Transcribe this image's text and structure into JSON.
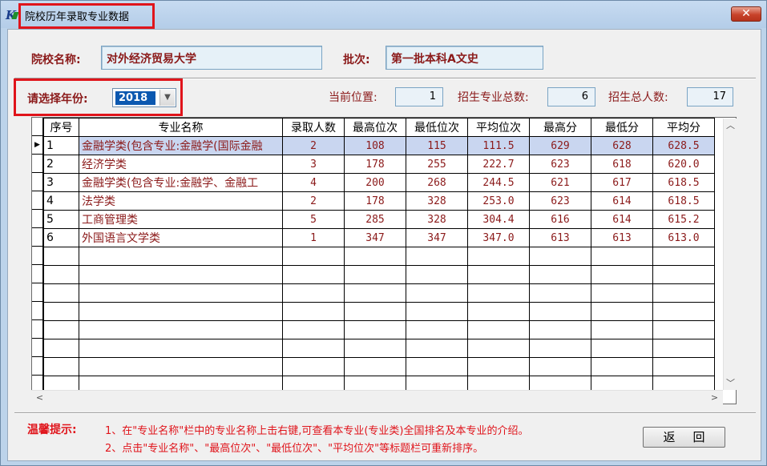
{
  "window": {
    "title": "院校历年录取专业数据",
    "close_label": "✕"
  },
  "school": {
    "name_label": "院校名称:",
    "name_value": "对外经济贸易大学",
    "batch_label": "批次:",
    "batch_value": "第一批本科A文史"
  },
  "year": {
    "label": "请选择年份:",
    "selected": "2018"
  },
  "info": {
    "position_label": "当前位置:",
    "position_value": "1",
    "majors_total_label": "招生专业总数:",
    "majors_total_value": "6",
    "students_total_label": "招生总人数:",
    "students_total_value": "17"
  },
  "table": {
    "columns": [
      "序号",
      "专业名称",
      "录取人数",
      "最高位次",
      "最低位次",
      "平均位次",
      "最高分",
      "最低分",
      "平均分"
    ],
    "selected_row": 0,
    "rows": [
      [
        "1",
        "金融学类(包含专业:金融学(国际金融",
        "2",
        "108",
        "115",
        "111.5",
        "629",
        "628",
        "628.5"
      ],
      [
        "2",
        "经济学类",
        "3",
        "178",
        "255",
        "222.7",
        "623",
        "618",
        "620.0"
      ],
      [
        "3",
        "金融学类(包含专业:金融学、金融工",
        "4",
        "200",
        "268",
        "244.5",
        "621",
        "617",
        "618.5"
      ],
      [
        "4",
        "法学类",
        "2",
        "178",
        "328",
        "253.0",
        "623",
        "614",
        "618.5"
      ],
      [
        "5",
        "工商管理类",
        "5",
        "285",
        "328",
        "304.4",
        "616",
        "614",
        "615.2"
      ],
      [
        "6",
        "外国语言文学类",
        "1",
        "347",
        "347",
        "347.0",
        "613",
        "613",
        "613.0"
      ]
    ],
    "empty_rows": 9
  },
  "tips": {
    "label": "温馨提示:",
    "line1": "1、在\"专业名称\"栏中的专业名称上击右键,可查看本专业(专业类)全国排名及本专业的介绍。",
    "line2": "2、点击\"专业名称\"、\"最高位次\"、\"最低位次\"、\"平均位次\"等标题栏可重新排序。"
  },
  "buttons": {
    "back_label": "返回"
  },
  "colors": {
    "highlight_red": "#e0141b",
    "text_dark_red": "#8b1a1a",
    "selected_row": "#c9d6f0"
  }
}
